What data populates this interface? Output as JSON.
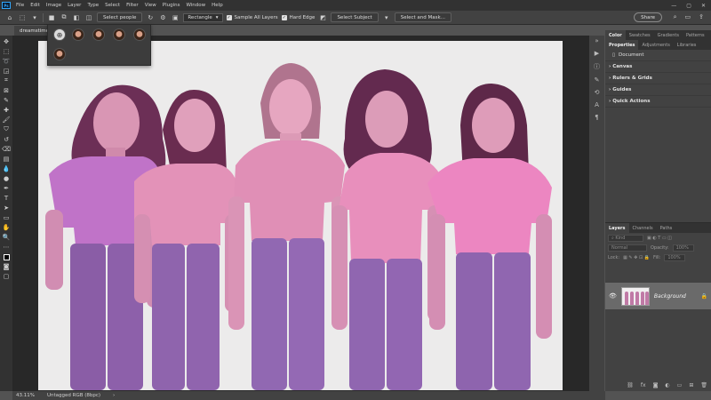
{
  "menu": [
    "File",
    "Edit",
    "Image",
    "Layer",
    "Type",
    "Select",
    "Filter",
    "View",
    "Plugins",
    "Window",
    "Help"
  ],
  "options": {
    "select_people": "Select people",
    "shape_mode": "Rectangle",
    "sample_all_layers": "Sample All Layers",
    "hard_edge": "Hard Edge",
    "select_subject": "Select Subject",
    "select_and_mask": "Select and Mask...",
    "share": "Share"
  },
  "doc_tab": "dreamstime",
  "panels": {
    "top_tabs": [
      "Color",
      "Swatches",
      "Gradients",
      "Patterns"
    ],
    "prop_tabs": [
      "Properties",
      "Adjustments",
      "Libraries"
    ],
    "document_label": "Document",
    "sections": [
      "Canvas",
      "Rulers & Grids",
      "Guides",
      "Quick Actions"
    ]
  },
  "layers": {
    "tabs": [
      "Layers",
      "Channels",
      "Paths"
    ],
    "kind_label": "Kind",
    "blend_mode": "Normal",
    "opacity_label": "Opacity:",
    "opacity_value": "100%",
    "lock_label": "Lock:",
    "fill_label": "Fill:",
    "fill_value": "100%",
    "layer_name": "Background"
  },
  "status": {
    "zoom": "43.11%",
    "color_profile": "Untagged RGB (8bpc)"
  },
  "colors": {
    "accent": "#31a8ff",
    "selection_overlay": "#c878c0"
  }
}
